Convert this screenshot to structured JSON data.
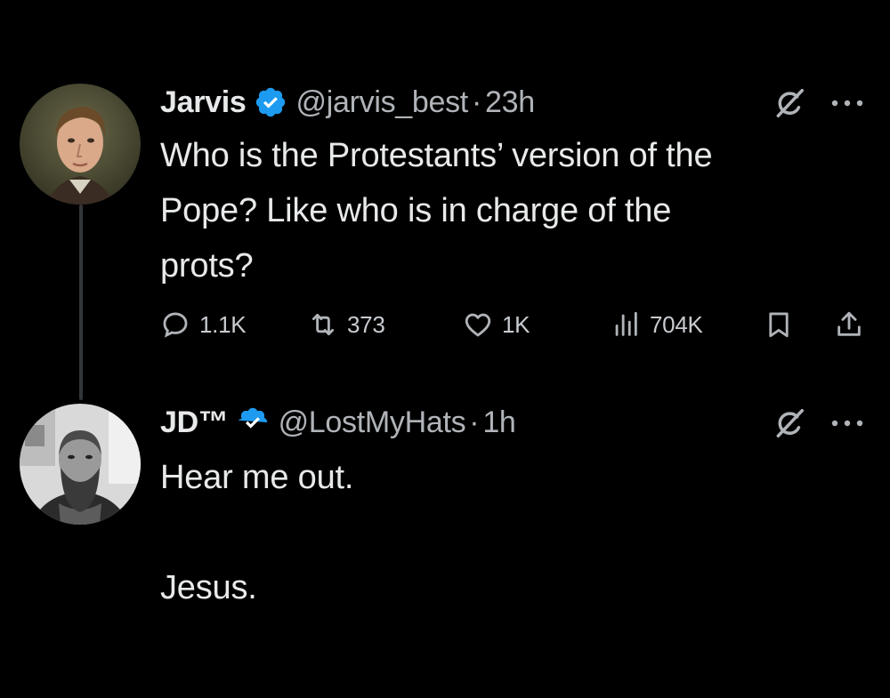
{
  "colors": {
    "background": "#000000",
    "text_primary": "#e7e9ea",
    "text_secondary": "#b0b4b9",
    "verified_blue": "#1d9bf0",
    "thread_line": "#333639"
  },
  "tweets": [
    {
      "display_name": "Jarvis",
      "handle": "@jarvis_best",
      "separator": "·",
      "time": "23h",
      "text": "Who is the Protestants’ version of the\nPope? Like who is in charge of the\nprots?",
      "verified_icon": "verified-badge-icon",
      "actions": {
        "replies": "1.1K",
        "retweets": "373",
        "likes": "1K",
        "views": "704K"
      }
    },
    {
      "display_name": "JD™",
      "handle": "@LostMyHats",
      "separator": "·",
      "time": "1h",
      "text": "Hear me out.\n\nJesus.",
      "verified_icon": "verified-badge-icon"
    }
  ],
  "icons": {
    "reply": "reply-icon",
    "retweet": "retweet-icon",
    "like": "heart-icon",
    "views": "views-chart-icon",
    "bookmark": "bookmark-icon",
    "share": "share-icon",
    "grok": "grok-icon",
    "more": "more-dots-icon"
  }
}
